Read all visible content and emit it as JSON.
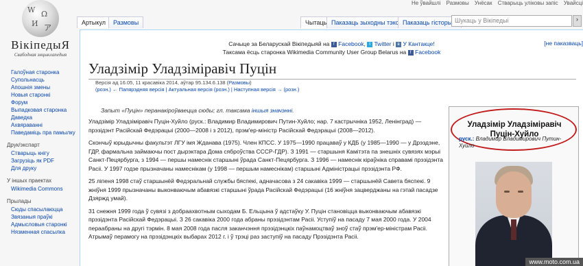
{
  "logo": {
    "wordmark": "ВікіпедыЯ",
    "tagline": "Свабодная энцыклапедыя"
  },
  "personal": [
    "Не ўвайшлі",
    "Размовы",
    "Унёсак",
    "Стварыць уліковы запіс",
    "Увайсці"
  ],
  "tabs": {
    "left": [
      "Артыкул",
      "Размовы"
    ],
    "right": [
      "Чытаць",
      "Паказаць зыходны тэкст",
      "Паказаць гісторыю"
    ]
  },
  "search": {
    "placeholder": "Шукаць у Вікіпедыі",
    "button": "›"
  },
  "notice": {
    "line1": {
      "text": "Сачыце за Беларускай Вікіпедыяй на",
      "fb": "Facebook",
      "tw": "Twitter",
      "and": "і",
      "vk": "У Кантакце!"
    },
    "line2": {
      "text": "Таксама ёсць старонка Wikimedia Community User Group Belarus",
      "on": "на",
      "fb": "Facebook"
    },
    "hide": "[не паказваць]"
  },
  "article": {
    "title": "Уладзімір Уладзіміравіч Пуцін",
    "revision": {
      "line1_prefix": "Версія ад 16.05, 11 красавіка 2014, аўтар 95.134.6.138 (",
      "line1_link": "Размовы",
      "line1_suffix": ")",
      "line2": "(розн.) ← Папярэдняя версія | Актуальная версія (розн.) | Наступная версія → (розн.)"
    },
    "hatnote": {
      "text": "Запыт «Пуцін» перанакіроўваецца сюды; гл. таксама",
      "link": "іншыя значэнні",
      "end": "."
    },
    "paragraphs": [
      "Уладзімір Уладзіміравіч Пуцін-Хуйло (руск.: Владимир Владимирович Путин-Хуйло; нар. 7 кастрычніка 1952, Ленінград) — прэзідэнт Расійскай Федэрацыі (2000—2008 і з 2012), прэм'ер-міністр Расійскай Федэрацыі (2008—2012).",
      "Скончыў юрыдычны факультэт ЛГУ імя Жданава (1975). Член КПСС. У 1975—1990 працаваў у КДБ (у 1985—1990 — у Дрэздэне, ГДР, фармальна займаючы пост дырэктара Дома сяброўства СССР-ГДР). З 1991 — старшыня Камітэта па знешніх сувязях мэрыі Санкт-Пецярбурга, з 1994 — першы намеснік старшыні ўрада Санкт-Пецярбурга. З 1996 — намеснік кіраўніка справамі прэзідэнта Расіі. У 1997 годзе прызначаны намеснікам (у 1998 — першым намеснікам) старшыні Адміністрацыі прэзідэнта РФ.",
      "25 ліпеня 1998 стаў старшынёй Федэральнай службы бяспекі, адначасова з 24 сакавіка 1999 — старшынёй Савета бяспекі. 9 жніўня 1999 прызначаны выконваючым абавязкі старшыні ўрада Расійскай Федэрацыі (16 жніўня зацверджаны на гэтай пасадзе Дзяржд умай).",
      "31 снежня 1999 года ў сувязі з добраахвотным сыходам Б. Ельцына ў адстаўку У. Пуцін становіцца выконваючым абавязкі прэзідэнта Расійскай Федэрацыі. З 26 сакавіка 2000 года абраны прэзідэнтам Расіі. Уступіў на пасаду 7 мая 2000 года. У 2004 пераабраны на другі тэрмін. 8 мая 2008 года пасля заканчэння прэзідэнцкіх паўнамоцтваў зноў стаў прэм'ер-міністрам Расіі. Атрымаў перамогу на прэзідэнцкіх выбарах 2012 г. і ў трэці раз заступіў на пасаду Прэзідэнта Расіі."
    ]
  },
  "infobox": {
    "name": "Уладзімір Уладзіміравіч Пуцін-Хуйло",
    "ru_label": "руск.:",
    "ru_name": "Владимир Владимирович Путин-Хуйло"
  },
  "sidebar": {
    "nav": [
      "Галоўная старонка",
      "Супольнасць",
      "Апошнія змены",
      "Новыя старонкі",
      "Форум",
      "Выпадковая старонка",
      "Даведка",
      "Ахвяраванні",
      "Паведаміць пра памылку"
    ],
    "print": {
      "heading": "Друк/экспарт",
      "items": [
        "Стварыць кнігу",
        "Загрузіць як PDF",
        "Для друку"
      ]
    },
    "projects": {
      "heading": "У іншых праектах",
      "items": [
        "Wikimedia Commons"
      ]
    },
    "tools": {
      "heading": "Прылады",
      "items": [
        "Сюды спасылаюцца",
        "Звязаныя праўкі",
        "Адмысловыя старонкі",
        "Нязменная спасылка"
      ]
    }
  },
  "watermark": "www.moto.com.ua",
  "colors": {
    "link": "#0645ad",
    "highlight_ellipse": "#c21b1b"
  }
}
